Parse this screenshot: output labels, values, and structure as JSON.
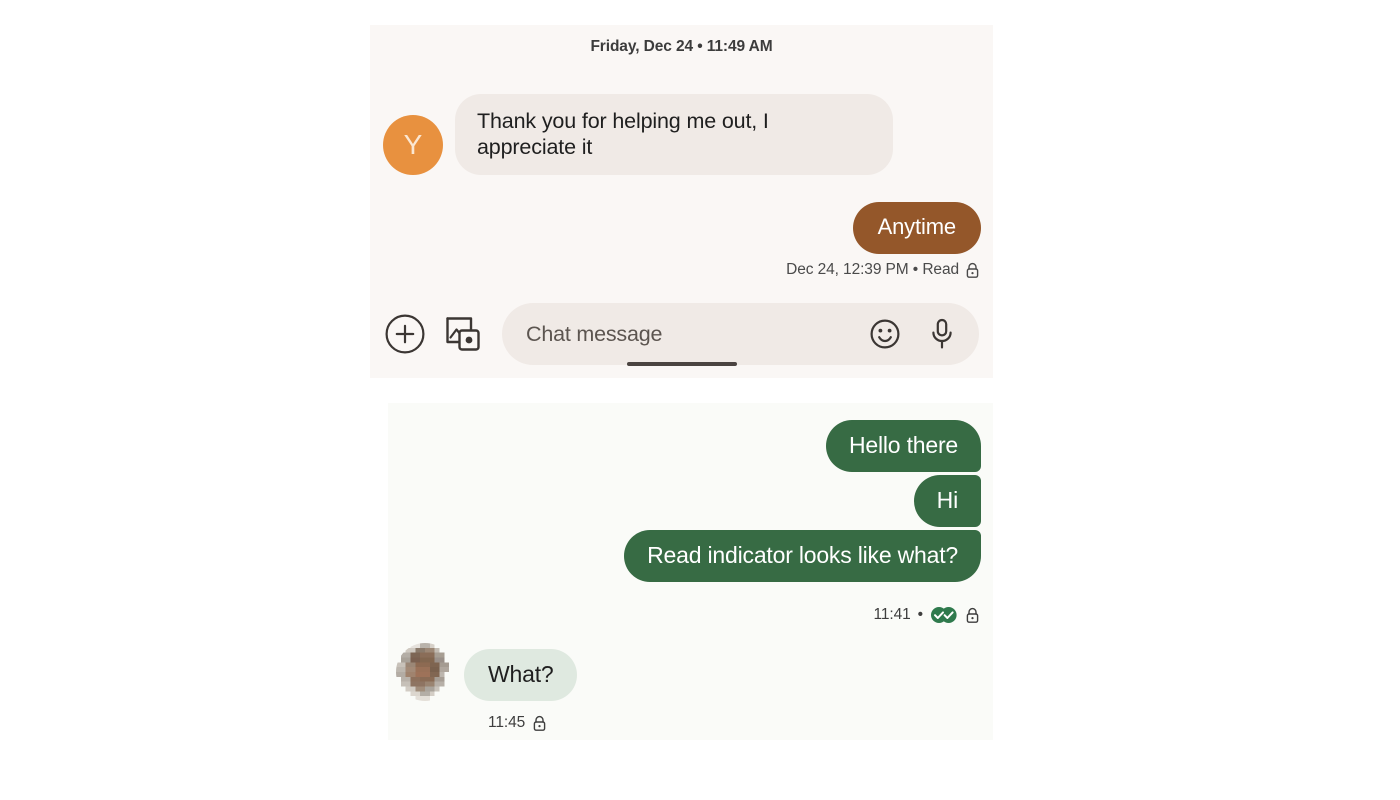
{
  "conversations": [
    {
      "id": "conversation-cream",
      "theme": {
        "background": "#faf7f5",
        "incoming_bubble": "#f0eae6",
        "outgoing_bubble": "#94572a",
        "avatar": "#e8913f"
      },
      "date_divider": "Friday, Dec 24 • 11:49 AM",
      "messages": [
        {
          "direction": "incoming",
          "avatar_letter": "Y",
          "text": "Thank you for helping me out, I appreciate it"
        },
        {
          "direction": "outgoing",
          "text": "Anytime",
          "status": "Dec 24, 12:39 PM • Read",
          "status_icon": "lock-icon"
        }
      ],
      "composer": {
        "placeholder": "Chat message",
        "value": "",
        "left_icons": [
          {
            "name": "plus-circle-icon",
            "label": "Add attachment"
          },
          {
            "name": "image-gallery-icon",
            "label": "Send image"
          }
        ],
        "right_icons": [
          {
            "name": "emoji-smiley-icon",
            "label": "Insert emoji"
          },
          {
            "name": "microphone-icon",
            "label": "Record voice message"
          }
        ]
      },
      "home_indicator": true
    },
    {
      "id": "conversation-green",
      "theme": {
        "background": "#fafbf8",
        "incoming_bubble": "#dfe9e0",
        "outgoing_bubble": "#376b44",
        "read_indicator": "#2f7a4d"
      },
      "messages": [
        {
          "direction": "outgoing",
          "text": "Hello there"
        },
        {
          "direction": "outgoing",
          "text": "Hi"
        },
        {
          "direction": "outgoing",
          "text": "Read indicator looks like what?",
          "status_time": "11:41",
          "status_separator": "•",
          "status_icons": [
            "double-check-read-icon",
            "lock-icon"
          ]
        },
        {
          "direction": "incoming",
          "avatar_type": "pixelated-photo",
          "text": "What?",
          "status_time": "11:45",
          "status_icons": [
            "lock-icon"
          ]
        }
      ]
    }
  ]
}
